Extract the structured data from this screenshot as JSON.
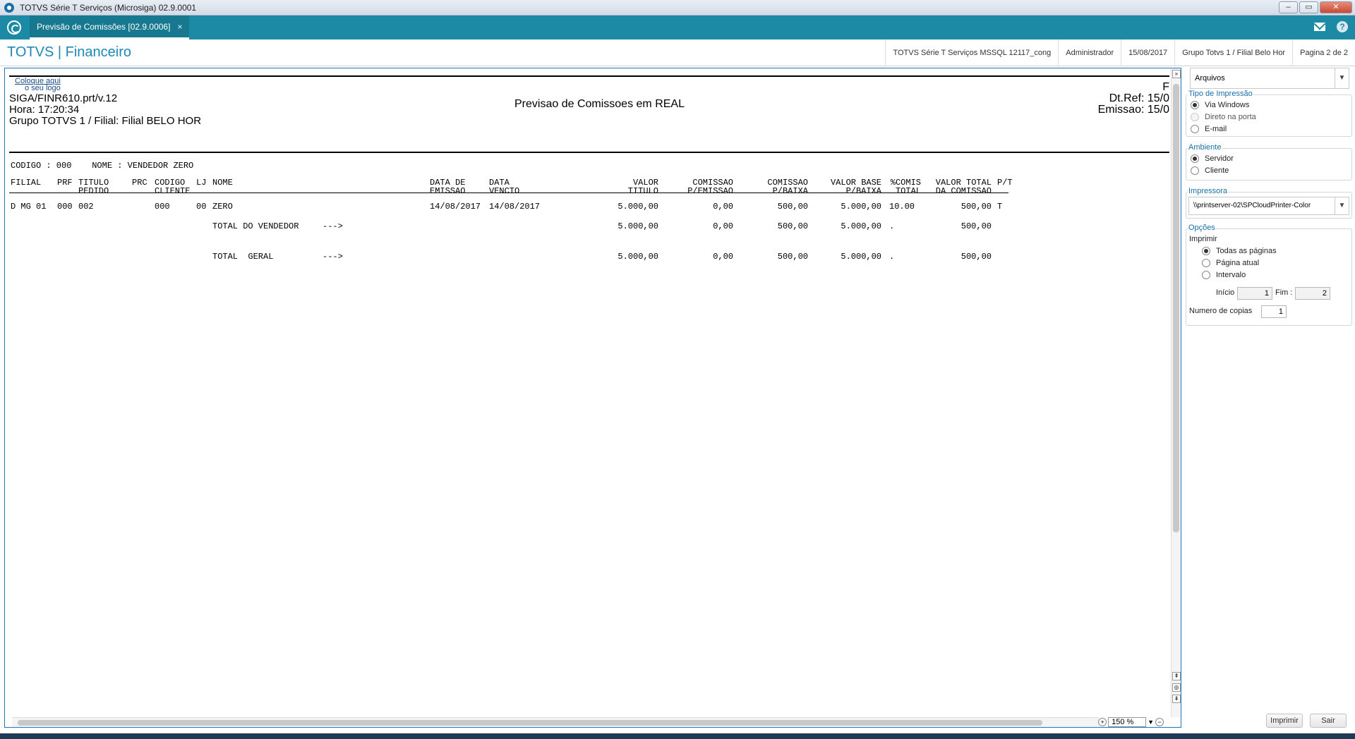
{
  "window": {
    "title": "TOTVS Série T Serviços (Microsiga) 02.9.0001"
  },
  "tab": {
    "label": "Previsão de Comissões [02.9.0006]",
    "close": "×"
  },
  "header": {
    "brand": "TOTVS | Financeiro",
    "info": [
      "TOTVS Série T Serviços MSSQL 12117_cong",
      "Administrador",
      "15/08/2017",
      "Grupo Totvs 1 / Filial Belo Hor",
      "Pagina 2 de 2"
    ]
  },
  "report": {
    "logo_line1": "Coloque aqui",
    "logo_line2": "o seu logo",
    "program": "SIGA/FINR610.prt/v.12",
    "hora": "Hora: 17:20:34",
    "grupo": "Grupo TOTVS 1 / Filial: Filial BELO HOR",
    "title": "Previsao de Comissoes em REAL",
    "right_top": "F",
    "dtref": "Dt.Ref: 15/0",
    "emissao": "Emissao: 15/0",
    "vendor_line": "CODIGO : 000    NOME : VENDEDOR ZERO",
    "columns": [
      {
        "l1": "FILIAL",
        "l2": ""
      },
      {
        "l1": "PRF",
        "l2": ""
      },
      {
        "l1": "TITULO",
        "l2": "PEDIDO"
      },
      {
        "l1": "PRC",
        "l2": ""
      },
      {
        "l1": "CODIGO",
        "l2": "CLIENTE"
      },
      {
        "l1": "LJ",
        "l2": ""
      },
      {
        "l1": "NOME",
        "l2": ""
      },
      {
        "l1": "DATA DE",
        "l2": "EMISSAO"
      },
      {
        "l1": "DATA",
        "l2": "VENCTO"
      },
      {
        "l1": "VALOR",
        "l2": "TITULO"
      },
      {
        "l1": "COMISSAO",
        "l2": "P/EMISSAO"
      },
      {
        "l1": "COMISSAO",
        "l2": "P/BAIXA"
      },
      {
        "l1": "VALOR BASE",
        "l2": "P/BAIXA"
      },
      {
        "l1": "%COMIS",
        "l2": "TOTAL"
      },
      {
        "l1": "VALOR TOTAL",
        "l2": "DA COMISSAO"
      },
      {
        "l1": "P/T",
        "l2": ""
      }
    ],
    "row": {
      "filial": "D MG 01",
      "prf": "000",
      "titulo": "002",
      "cliente": "000",
      "lj": "00",
      "nome": "ZERO",
      "emissao": "14/08/2017",
      "vencto": "14/08/2017",
      "valor": "5.000,00",
      "com_emissao": "0,00",
      "com_baixa": "500,00",
      "base_baixa": "5.000,00",
      "pct": "10.00",
      "total": "500,00",
      "pt": "T"
    },
    "total_vendedor": {
      "label": "TOTAL DO VENDEDOR",
      "arrow": "--->",
      "valor": "5.000,00",
      "com_emissao": "0,00",
      "com_baixa": "500,00",
      "base_baixa": "5.000,00",
      "pct": ".",
      "total": "500,00"
    },
    "total_geral": {
      "label": "TOTAL  GERAL",
      "arrow": "--->",
      "valor": "5.000,00",
      "com_emissao": "0,00",
      "com_baixa": "500,00",
      "base_baixa": "5.000,00",
      "pct": ".",
      "total": "500,00"
    },
    "zoom": "150 %"
  },
  "side": {
    "dest": "Arquivos",
    "tipo_label": "Tipo de Impressão",
    "tipo_opts": [
      "Via Windows",
      "Direto na porta",
      "E-mail"
    ],
    "ambiente_label": "Ambiente",
    "ambiente_opts": [
      "Servidor",
      "Cliente"
    ],
    "impressora_label": "Impressora",
    "impressora": "\\\\printserver-02\\SPCloudPrinter-Color",
    "opcoes_label": "Opções",
    "imprimir_label": "Imprimir",
    "imprimir_opts": [
      "Todas as páginas",
      "Página atual",
      "Intervalo"
    ],
    "inicio_label": "Início :",
    "inicio": "1",
    "fim_label": "Fim :",
    "fim": "2",
    "copias_label": "Numero de copias",
    "copias": "1",
    "btn_imprimir": "Imprimir",
    "btn_sair": "Sair"
  }
}
